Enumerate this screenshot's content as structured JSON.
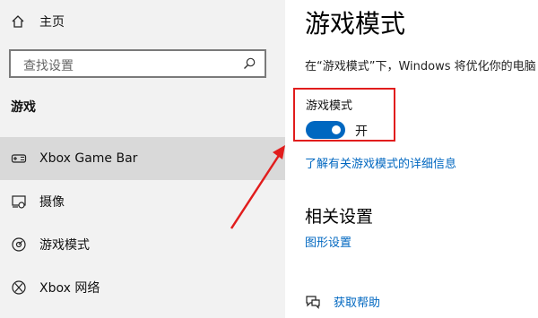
{
  "sidebar": {
    "home_label": "主页",
    "search_placeholder": "查找设置",
    "section_title": "游戏",
    "items": [
      {
        "label": "Xbox Game Bar",
        "icon": "game-bar-icon",
        "active": true
      },
      {
        "label": "摄像",
        "icon": "capture-icon",
        "active": false
      },
      {
        "label": "游戏模式",
        "icon": "game-mode-icon",
        "active": false
      },
      {
        "label": "Xbox 网络",
        "icon": "xbox-icon",
        "active": false
      }
    ]
  },
  "main": {
    "title": "游戏模式",
    "description": "在“游戏模式”下，Windows 将优化你的电脑",
    "toggle": {
      "label": "游戏模式",
      "state_text": "开",
      "on": true
    },
    "learn_more_link": "了解有关游戏模式的详细信息",
    "related_title": "相关设置",
    "graphics_link": "图形设置",
    "help_link": "获取帮助"
  },
  "colors": {
    "accent": "#0067c0",
    "highlight": "#e11d1d",
    "sidebar_bg": "#f2f2f2",
    "active_item_bg": "#d9d9d9"
  }
}
